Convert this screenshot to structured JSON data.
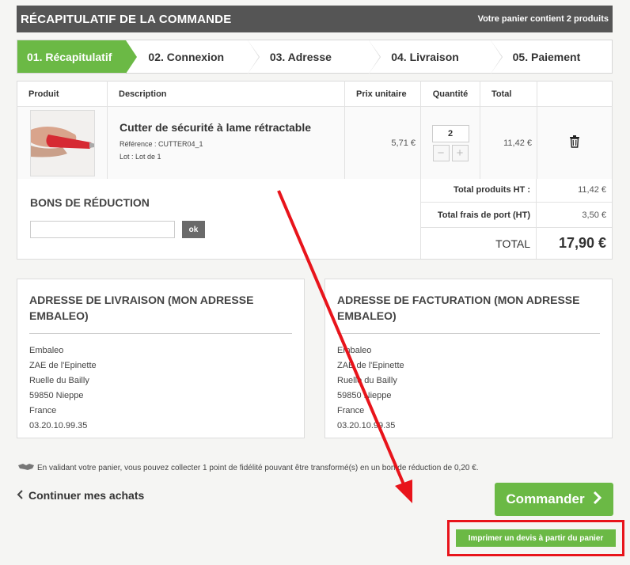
{
  "header": {
    "title": "RÉCAPITULATIF DE LA COMMANDE",
    "cart_summary": "Votre panier contient 2 produits"
  },
  "steps": [
    {
      "label": "01. Récapitulatif",
      "active": true
    },
    {
      "label": "02. Connexion",
      "active": false
    },
    {
      "label": "03. Adresse",
      "active": false
    },
    {
      "label": "04. Livraison",
      "active": false
    },
    {
      "label": "05. Paiement",
      "active": false
    }
  ],
  "table": {
    "headers": {
      "product": "Produit",
      "description": "Description",
      "unit_price": "Prix unitaire",
      "quantity": "Quantité",
      "total": "Total"
    },
    "item": {
      "image": "cutter-product-image",
      "name": "Cutter de sécurité à lame rétractable",
      "reference": "Référence : CUTTER04_1",
      "lot": "Lot : Lot de 1",
      "unit_price": "5,71 €",
      "quantity": "2",
      "minus": "−",
      "plus": "+",
      "total": "11,42 €",
      "delete_icon": "trash-icon"
    }
  },
  "vouchers": {
    "title": "BONS DE RÉDUCTION",
    "input_value": "",
    "button_label": "ok"
  },
  "totals": {
    "products_label": "Total produits HT :",
    "products_value": "11,42 €",
    "shipping_label": "Total frais de port (HT)",
    "shipping_value": "3,50 €",
    "total_label": "TOTAL",
    "total_value": "17,90 €"
  },
  "delivery_address": {
    "title": "ADRESSE DE LIVRAISON (MON ADRESSE EMBALEO)",
    "lines": [
      "Embaleo",
      "ZAE de l'Epinette",
      "Ruelle du Bailly",
      "59850 Nieppe",
      "France",
      "03.20.10.99.35"
    ]
  },
  "billing_address": {
    "title": "ADRESSE DE FACTURATION (MON ADRESSE EMBALEO)",
    "lines": [
      "Embaleo",
      "ZAE de l'Epinette",
      "Ruelle du Bailly",
      "59850 Nieppe",
      "France",
      "03.20.10.99.35"
    ]
  },
  "fidelity_text": "En validant votre panier, vous pouvez collecter 1 point de fidélité pouvant être transformé(s) en un bon de réduction de 0,20 €.",
  "continue_label": "Continuer mes achats",
  "order_button": "Commander",
  "quote_button": "Imprimer un devis à partir du panier",
  "colors": {
    "accent_green": "#6bb945",
    "header_gray": "#555555",
    "annotation_red": "#e8141b"
  }
}
